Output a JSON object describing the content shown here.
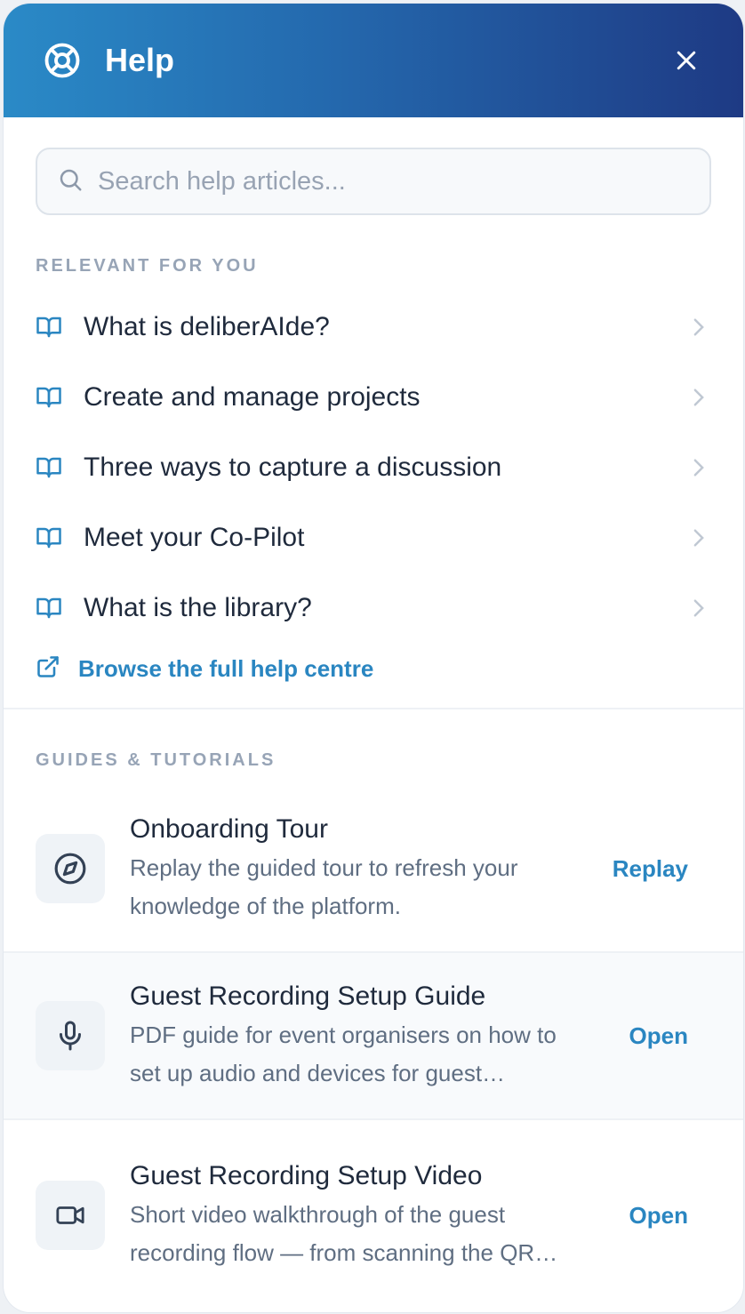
{
  "header": {
    "title": "Help",
    "icon": "lifebuoy-icon"
  },
  "search": {
    "placeholder": "Search help articles..."
  },
  "relevant": {
    "label": "RELEVANT FOR YOU",
    "items": [
      {
        "label": "What is deliberAIde?"
      },
      {
        "label": "Create and manage projects"
      },
      {
        "label": "Three ways to capture a discussion"
      },
      {
        "label": "Meet your Co-Pilot"
      },
      {
        "label": "What is the library?"
      }
    ],
    "browse_label": "Browse the full help centre"
  },
  "guides": {
    "label": "GUIDES & TUTORIALS",
    "items": [
      {
        "icon": "compass-icon",
        "title": "Onboarding Tour",
        "description": "Replay the guided tour to refresh your knowledge of the platform.",
        "action": "Replay"
      },
      {
        "icon": "microphone-icon",
        "title": "Guest Recording Setup Guide",
        "description": "PDF guide for event organisers on how to set up audio and devices for guest recording sessions.",
        "action": "Open"
      },
      {
        "icon": "video-camera-icon",
        "title": "Guest Recording Setup Video",
        "description": "Short video walkthrough of the guest recording flow — from scanning the QR code to uploading.",
        "action": "Open"
      }
    ]
  },
  "colors": {
    "accent": "#2a86c1",
    "header_start": "#2a8ac7",
    "header_end": "#1e3a84"
  }
}
